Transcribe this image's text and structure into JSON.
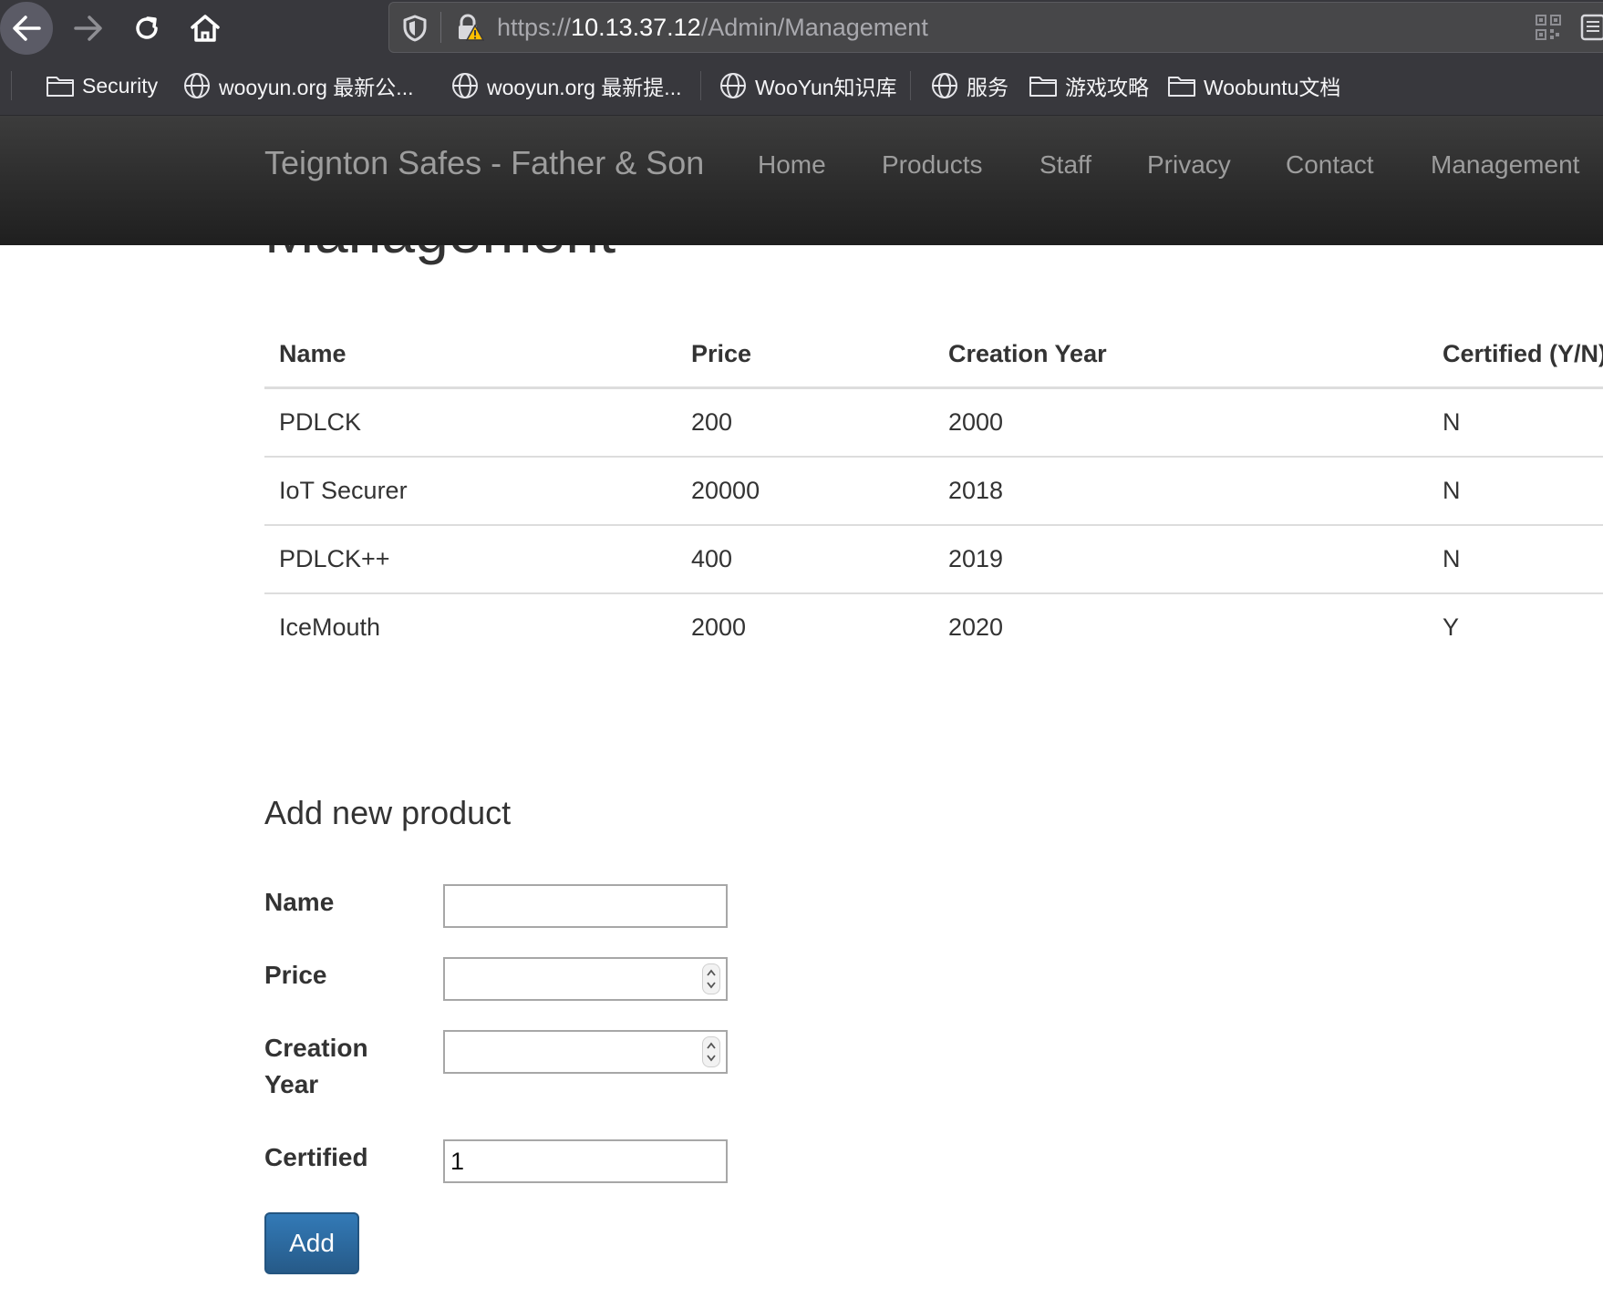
{
  "browser": {
    "url_scheme": "https://",
    "url_host": "10.13.37.12",
    "url_path": "/Admin/Management",
    "bookmarks": [
      {
        "label": "Security",
        "icon": "folder-icon"
      },
      {
        "label": "wooyun.org 最新公...",
        "icon": "globe-icon"
      },
      {
        "label": "wooyun.org 最新提...",
        "icon": "globe-icon"
      },
      {
        "label": "WooYun知识库",
        "icon": "globe-icon"
      },
      {
        "label": "服务",
        "icon": "globe-icon"
      },
      {
        "label": "游戏攻略",
        "icon": "folder-icon"
      },
      {
        "label": "Woobuntu文档",
        "icon": "folder-icon"
      }
    ]
  },
  "site": {
    "brand": "Teignton Safes - Father & Son",
    "nav": [
      "Home",
      "Products",
      "Staff",
      "Privacy",
      "Contact",
      "Management"
    ]
  },
  "page": {
    "title": "Management"
  },
  "table": {
    "headers": [
      "Name",
      "Price",
      "Creation Year",
      "Certified (Y/N)"
    ],
    "rows": [
      [
        "PDLCK",
        "200",
        "2000",
        "N"
      ],
      [
        "IoT Securer",
        "20000",
        "2018",
        "N"
      ],
      [
        "PDLCK++",
        "400",
        "2019",
        "N"
      ],
      [
        "IceMouth",
        "2000",
        "2020",
        "Y"
      ]
    ]
  },
  "form": {
    "heading": "Add new product",
    "name_label": "Name",
    "name_value": "",
    "price_label": "Price",
    "price_value": "",
    "year_label_line1": "Creation",
    "year_label_line2": "Year",
    "year_value": "",
    "certified_label": "Certified",
    "certified_value": "1",
    "submit_label": "Add"
  },
  "colors": {
    "chrome": "#38383d",
    "navbar": "#222222",
    "button": "#337ab7"
  }
}
